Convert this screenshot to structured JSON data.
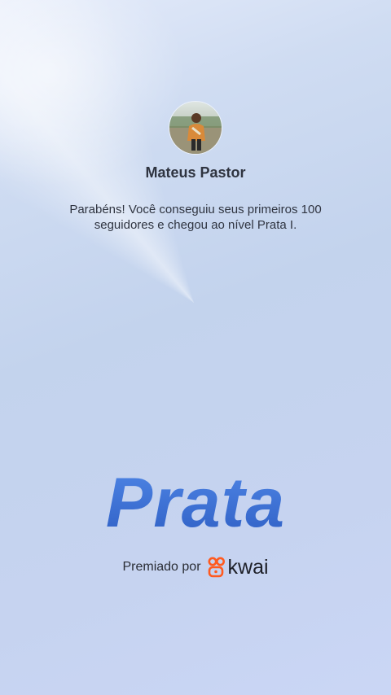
{
  "profile": {
    "name": "Mateus Pastor",
    "message": "Parabéns! Você conseguiu seus primeiros 100 seguidores e chegou ao nível Prata I."
  },
  "level": {
    "title": "Prata"
  },
  "award": {
    "text": "Premiado por",
    "brand": "kwai",
    "brand_color": "#ff5a1f"
  },
  "icons": {
    "avatar": "user-photo",
    "brand_logo": "kwai-logo-icon"
  },
  "colors": {
    "level_title": "#3f6fd0",
    "text": "#2f3440"
  }
}
